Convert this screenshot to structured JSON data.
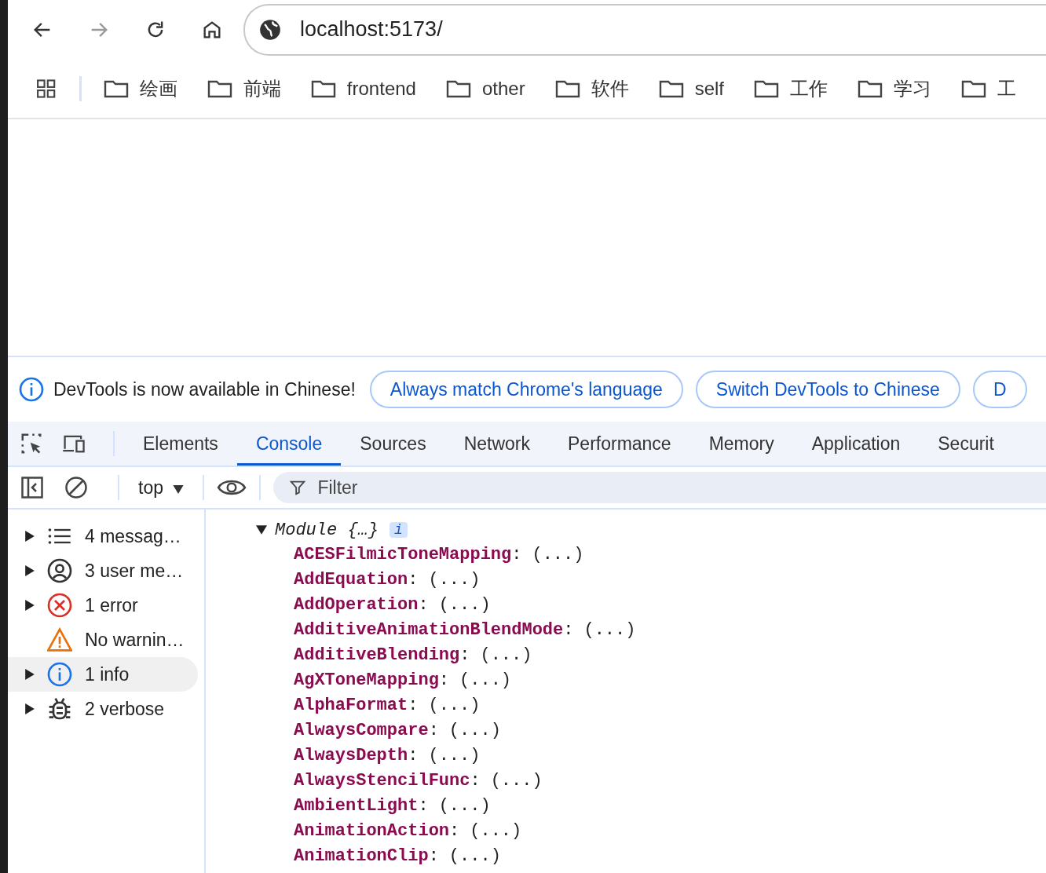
{
  "browser": {
    "url": "localhost:5173/"
  },
  "bookmarks": [
    {
      "label": "绘画"
    },
    {
      "label": "前端"
    },
    {
      "label": "frontend"
    },
    {
      "label": "other"
    },
    {
      "label": "软件"
    },
    {
      "label": "self"
    },
    {
      "label": "工作"
    },
    {
      "label": "学习"
    },
    {
      "label": "工"
    }
  ],
  "infobar": {
    "message": "DevTools is now available in Chinese!",
    "buttons": [
      "Always match Chrome's language",
      "Switch DevTools to Chinese",
      "D"
    ]
  },
  "devtools_tabs": [
    {
      "label": "Elements",
      "selected": false
    },
    {
      "label": "Console",
      "selected": true
    },
    {
      "label": "Sources",
      "selected": false
    },
    {
      "label": "Network",
      "selected": false
    },
    {
      "label": "Performance",
      "selected": false
    },
    {
      "label": "Memory",
      "selected": false
    },
    {
      "label": "Application",
      "selected": false
    },
    {
      "label": "Securit",
      "selected": false
    }
  ],
  "console_toolbar": {
    "context": "top",
    "filter_placeholder": "Filter"
  },
  "sidebar": {
    "items": [
      {
        "kind": "messages",
        "label": "4 messag…",
        "expandable": true,
        "selected": false
      },
      {
        "kind": "user",
        "label": "3 user me…",
        "expandable": true,
        "selected": false
      },
      {
        "kind": "error",
        "label": "1 error",
        "expandable": true,
        "selected": false
      },
      {
        "kind": "warning",
        "label": "No warnin…",
        "expandable": false,
        "selected": false
      },
      {
        "kind": "info",
        "label": "1 info",
        "expandable": true,
        "selected": true
      },
      {
        "kind": "verbose",
        "label": "2 verbose",
        "expandable": true,
        "selected": false
      }
    ]
  },
  "console": {
    "separator": ":",
    "object": {
      "label": "Module {…}",
      "expanded": true,
      "badge": "i",
      "properties": [
        {
          "key": "ACESFilmicToneMapping",
          "value": "(...)"
        },
        {
          "key": "AddEquation",
          "value": "(...)"
        },
        {
          "key": "AddOperation",
          "value": "(...)"
        },
        {
          "key": "AdditiveAnimationBlendMode",
          "value": "(...)"
        },
        {
          "key": "AdditiveBlending",
          "value": "(...)"
        },
        {
          "key": "AgXToneMapping",
          "value": "(...)"
        },
        {
          "key": "AlphaFormat",
          "value": "(...)"
        },
        {
          "key": "AlwaysCompare",
          "value": "(...)"
        },
        {
          "key": "AlwaysDepth",
          "value": "(...)"
        },
        {
          "key": "AlwaysStencilFunc",
          "value": "(...)"
        },
        {
          "key": "AmbientLight",
          "value": "(...)"
        },
        {
          "key": "AnimationAction",
          "value": "(...)"
        },
        {
          "key": "AnimationClip",
          "value": "(...)"
        }
      ]
    }
  }
}
